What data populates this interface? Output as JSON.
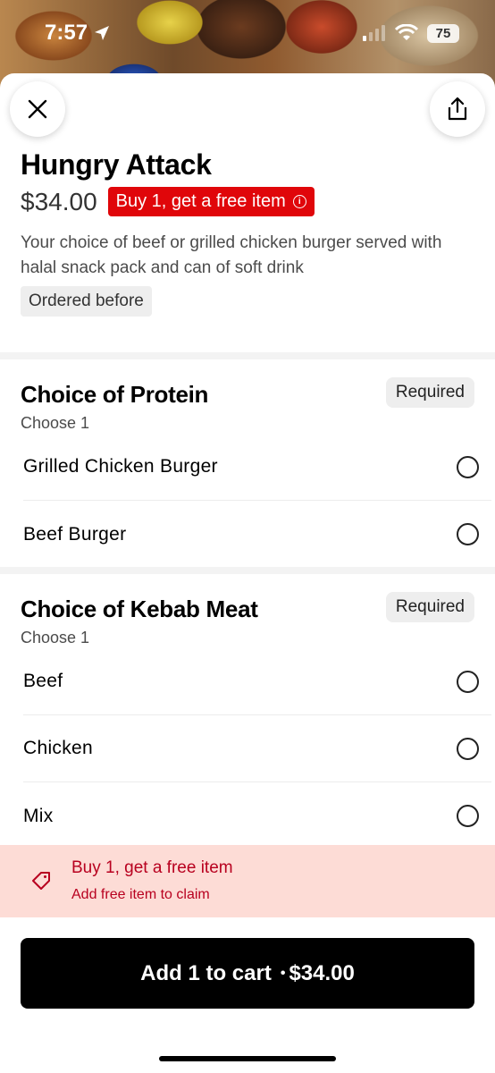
{
  "status_bar": {
    "time": "7:57",
    "battery": "75"
  },
  "item": {
    "title": "Hungry Attack",
    "price": "$34.00",
    "promo_badge": "Buy 1, get a free item",
    "description": "Your choice of beef or grilled chicken burger served with halal snack pack and can of soft drink",
    "tag": "Ordered before"
  },
  "groups": [
    {
      "title": "Choice of Protein",
      "subtitle": "Choose 1",
      "required": "Required",
      "options": [
        {
          "label": "Grilled Chicken Burger"
        },
        {
          "label": "Beef Burger"
        }
      ]
    },
    {
      "title": "Choice of Kebab Meat",
      "subtitle": "Choose 1",
      "required": "Required",
      "options": [
        {
          "label": "Beef"
        },
        {
          "label": "Chicken"
        },
        {
          "label": "Mix"
        }
      ]
    }
  ],
  "promo_banner": {
    "title": "Buy 1, get a free item",
    "subtitle": "Add free item to claim"
  },
  "cart_button": {
    "label": "Add 1 to cart",
    "separator": "•",
    "price": "$34.00"
  },
  "colors": {
    "promo_red": "#e0060a",
    "banner_bg": "#fddcd6",
    "banner_text": "#b8001f",
    "cart_bg": "#000000"
  },
  "icons": [
    "location-arrow-icon",
    "wifi-icon",
    "close-icon",
    "share-icon",
    "info-icon",
    "tag-icon"
  ]
}
